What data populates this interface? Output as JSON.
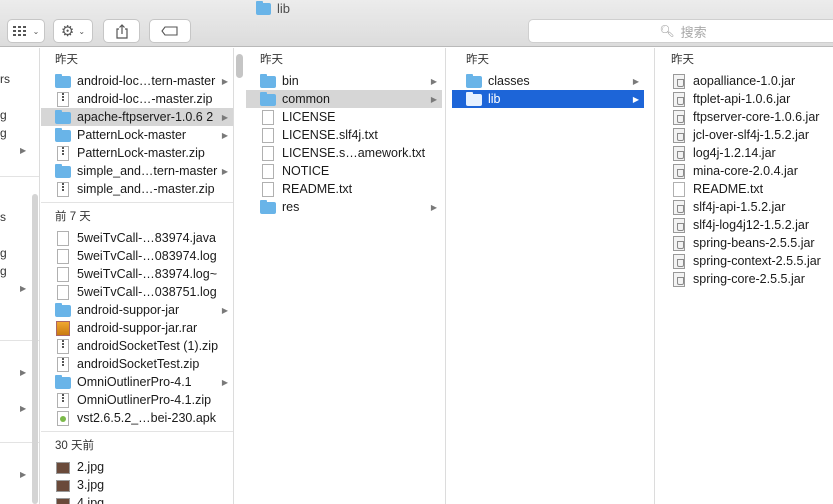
{
  "window": {
    "title": "lib"
  },
  "toolbar": {
    "view_icon": "grid-icon",
    "action_icon": "gear-icon",
    "share_icon": "share-icon",
    "tag_icon": "tag-icon",
    "search_placeholder": "搜索"
  },
  "left_column": {
    "fragments": [
      "rs",
      "g",
      "g",
      "s",
      "g",
      "g"
    ]
  },
  "col1": {
    "groups": [
      {
        "header": "昨天",
        "items": [
          {
            "name": "android-loc…tern-master",
            "type": "folder",
            "arrow": true
          },
          {
            "name": "android-loc…-master.zip",
            "type": "zip",
            "arrow": false
          },
          {
            "name": "apache-ftpserver-1.0.6 2",
            "type": "folder",
            "arrow": true,
            "selected": "gray"
          },
          {
            "name": "PatternLock-master",
            "type": "folder",
            "arrow": true
          },
          {
            "name": "PatternLock-master.zip",
            "type": "zip",
            "arrow": false
          },
          {
            "name": "simple_and…tern-master",
            "type": "folder",
            "arrow": true
          },
          {
            "name": "simple_and…-master.zip",
            "type": "zip",
            "arrow": false
          }
        ]
      },
      {
        "header": "前 7 天",
        "items": [
          {
            "name": "5weiTvCall-…83974.java",
            "type": "doc",
            "arrow": false
          },
          {
            "name": "5weiTvCall-…083974.log",
            "type": "doc",
            "arrow": false
          },
          {
            "name": "5weiTvCall-…83974.log~",
            "type": "doc",
            "arrow": false
          },
          {
            "name": "5weiTvCall-…038751.log",
            "type": "doc",
            "arrow": false
          },
          {
            "name": "android-suppor-jar",
            "type": "folder",
            "arrow": true
          },
          {
            "name": "android-suppor-jar.rar",
            "type": "rar",
            "arrow": false
          },
          {
            "name": "androidSocketTest (1).zip",
            "type": "zip",
            "arrow": false
          },
          {
            "name": "androidSocketTest.zip",
            "type": "zip",
            "arrow": false
          },
          {
            "name": "OmniOutlinerPro-4.1",
            "type": "folder",
            "arrow": true
          },
          {
            "name": "OmniOutlinerPro-4.1.zip",
            "type": "zip",
            "arrow": false
          },
          {
            "name": "vst2.6.5.2_…bei-230.apk",
            "type": "apk",
            "arrow": false
          }
        ]
      },
      {
        "header": "30 天前",
        "items": [
          {
            "name": "2.jpg",
            "type": "img",
            "arrow": false
          },
          {
            "name": "3.jpg",
            "type": "img",
            "arrow": false
          },
          {
            "name": "4.jpg",
            "type": "img",
            "arrow": false
          }
        ]
      }
    ]
  },
  "col2": {
    "header": "昨天",
    "items": [
      {
        "name": "bin",
        "type": "folder",
        "arrow": true
      },
      {
        "name": "common",
        "type": "folder",
        "arrow": true,
        "selected": "gray"
      },
      {
        "name": "LICENSE",
        "type": "doc",
        "arrow": false
      },
      {
        "name": "LICENSE.slf4j.txt",
        "type": "doc",
        "arrow": false
      },
      {
        "name": "LICENSE.s…amework.txt",
        "type": "doc",
        "arrow": false
      },
      {
        "name": "NOTICE",
        "type": "doc",
        "arrow": false
      },
      {
        "name": "README.txt",
        "type": "doc",
        "arrow": false
      },
      {
        "name": "res",
        "type": "folder",
        "arrow": true
      }
    ]
  },
  "col3": {
    "header": "昨天",
    "items": [
      {
        "name": "classes",
        "type": "folder",
        "arrow": true
      },
      {
        "name": "lib",
        "type": "folder",
        "arrow": true,
        "selected": "blue"
      }
    ]
  },
  "col4": {
    "header": "昨天",
    "items": [
      {
        "name": "aopalliance-1.0.jar",
        "type": "jar"
      },
      {
        "name": "ftplet-api-1.0.6.jar",
        "type": "jar"
      },
      {
        "name": "ftpserver-core-1.0.6.jar",
        "type": "jar"
      },
      {
        "name": "jcl-over-slf4j-1.5.2.jar",
        "type": "jar"
      },
      {
        "name": "log4j-1.2.14.jar",
        "type": "jar"
      },
      {
        "name": "mina-core-2.0.4.jar",
        "type": "jar"
      },
      {
        "name": "README.txt",
        "type": "doc"
      },
      {
        "name": "slf4j-api-1.5.2.jar",
        "type": "jar"
      },
      {
        "name": "slf4j-log4j12-1.5.2.jar",
        "type": "jar"
      },
      {
        "name": "spring-beans-2.5.5.jar",
        "type": "jar"
      },
      {
        "name": "spring-context-2.5.5.jar",
        "type": "jar"
      },
      {
        "name": "spring-core-2.5.5.jar",
        "type": "jar"
      }
    ]
  }
}
